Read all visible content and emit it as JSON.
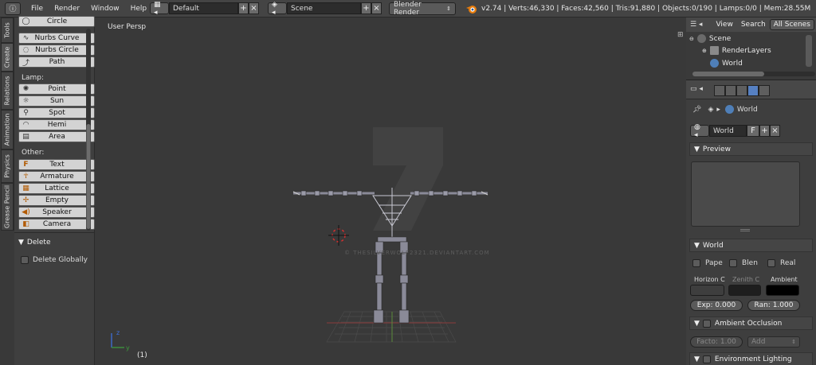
{
  "topbar": {
    "menus": [
      "File",
      "Render",
      "Window",
      "Help"
    ],
    "screen_layout": "Default",
    "scene": "Scene",
    "render_engine": "Blender Render",
    "stats": "v2.74 | Verts:46,330 | Faces:42,560 | Tris:91,880 | Objects:0/190 | Lamps:0/0 | Mem:28.55M"
  },
  "vtabs": [
    "Tools",
    "Create",
    "Relations",
    "Animation",
    "Physics",
    "Grease Pencil"
  ],
  "toolshelf": {
    "mesh_items": [
      "Circle",
      "Nurbs Curve",
      "Nurbs Circle",
      "Path"
    ],
    "lamp_label": "Lamp:",
    "lamp_items": [
      "Point",
      "Sun",
      "Spot",
      "Hemi",
      "Area"
    ],
    "other_label": "Other:",
    "other_items": [
      "Text",
      "Armature",
      "Lattice",
      "Empty",
      "Speaker",
      "Camera"
    ],
    "delete_panel": "Delete",
    "delete_globally": "Delete Globally"
  },
  "viewport": {
    "view_name": "User Persp",
    "frame": "(1)",
    "watermark": "© THESILVERWOLF2321.DEVIANTART.COM"
  },
  "outliner": {
    "view": "View",
    "search": "Search",
    "display_mode": "All Scenes",
    "items": [
      "Scene",
      "RenderLayers",
      "World"
    ]
  },
  "properties": {
    "breadcrumb": "World",
    "world_name": "World",
    "fake_user": "F",
    "preview": "Preview",
    "world_panel": "World",
    "paper": "Pape",
    "blend": "Blen",
    "real": "Real",
    "horizon": "Horizon C",
    "zenith": "Zenith C",
    "ambient": "Ambient",
    "exposure": "Exp: 0.000",
    "range": "Ran: 1.000",
    "ao_panel": "Ambient Occlusion",
    "factor": "Facto: 1.00",
    "add": "Add",
    "env_panel": "Environment Lighting"
  },
  "colors": {
    "horizon": "#3e3e3e",
    "zenith": "#1e1e1e",
    "ambient": "#000000",
    "accent": "#5680c2"
  }
}
